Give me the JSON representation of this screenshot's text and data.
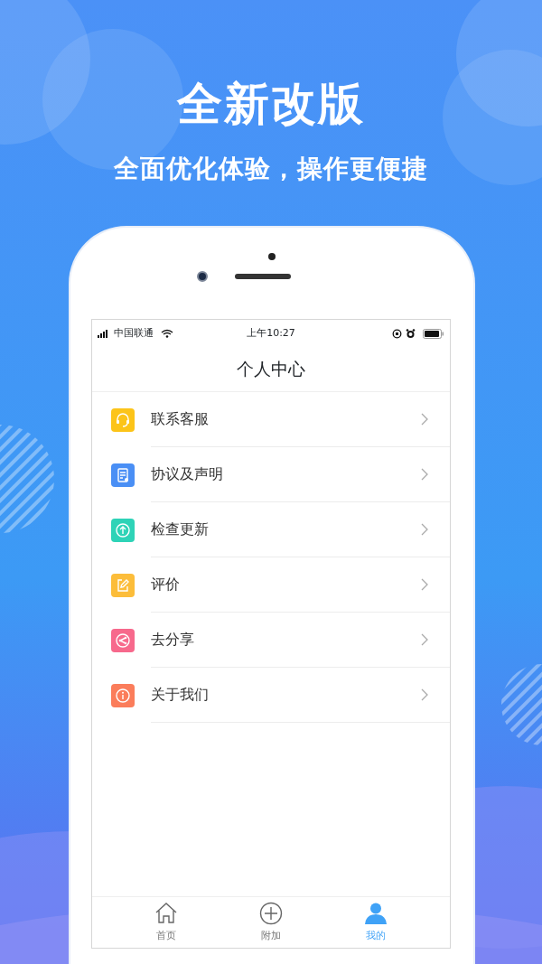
{
  "headline": "全新改版",
  "subtitle": "全面优化体验，操作更便捷",
  "status_bar": {
    "carrier": "中国联通",
    "time": "上午10:27"
  },
  "page_title": "个人中心",
  "menu": [
    {
      "label": "联系客服",
      "kind": "headset",
      "color": "#fcc419"
    },
    {
      "label": "协议及声明",
      "kind": "document",
      "color": "#4a8ff5"
    },
    {
      "label": "检查更新",
      "kind": "upload",
      "color": "#2ed3b7"
    },
    {
      "label": "评价",
      "kind": "edit",
      "color": "#fcbd3a"
    },
    {
      "label": "去分享",
      "kind": "share",
      "color": "#f7698c"
    },
    {
      "label": "关于我们",
      "kind": "info",
      "color": "#fb7d5b"
    }
  ],
  "tabs": [
    {
      "label": "首页",
      "kind": "home",
      "selected": false
    },
    {
      "label": "附加",
      "kind": "add",
      "selected": false
    },
    {
      "label": "我的",
      "kind": "person",
      "selected": true
    }
  ]
}
